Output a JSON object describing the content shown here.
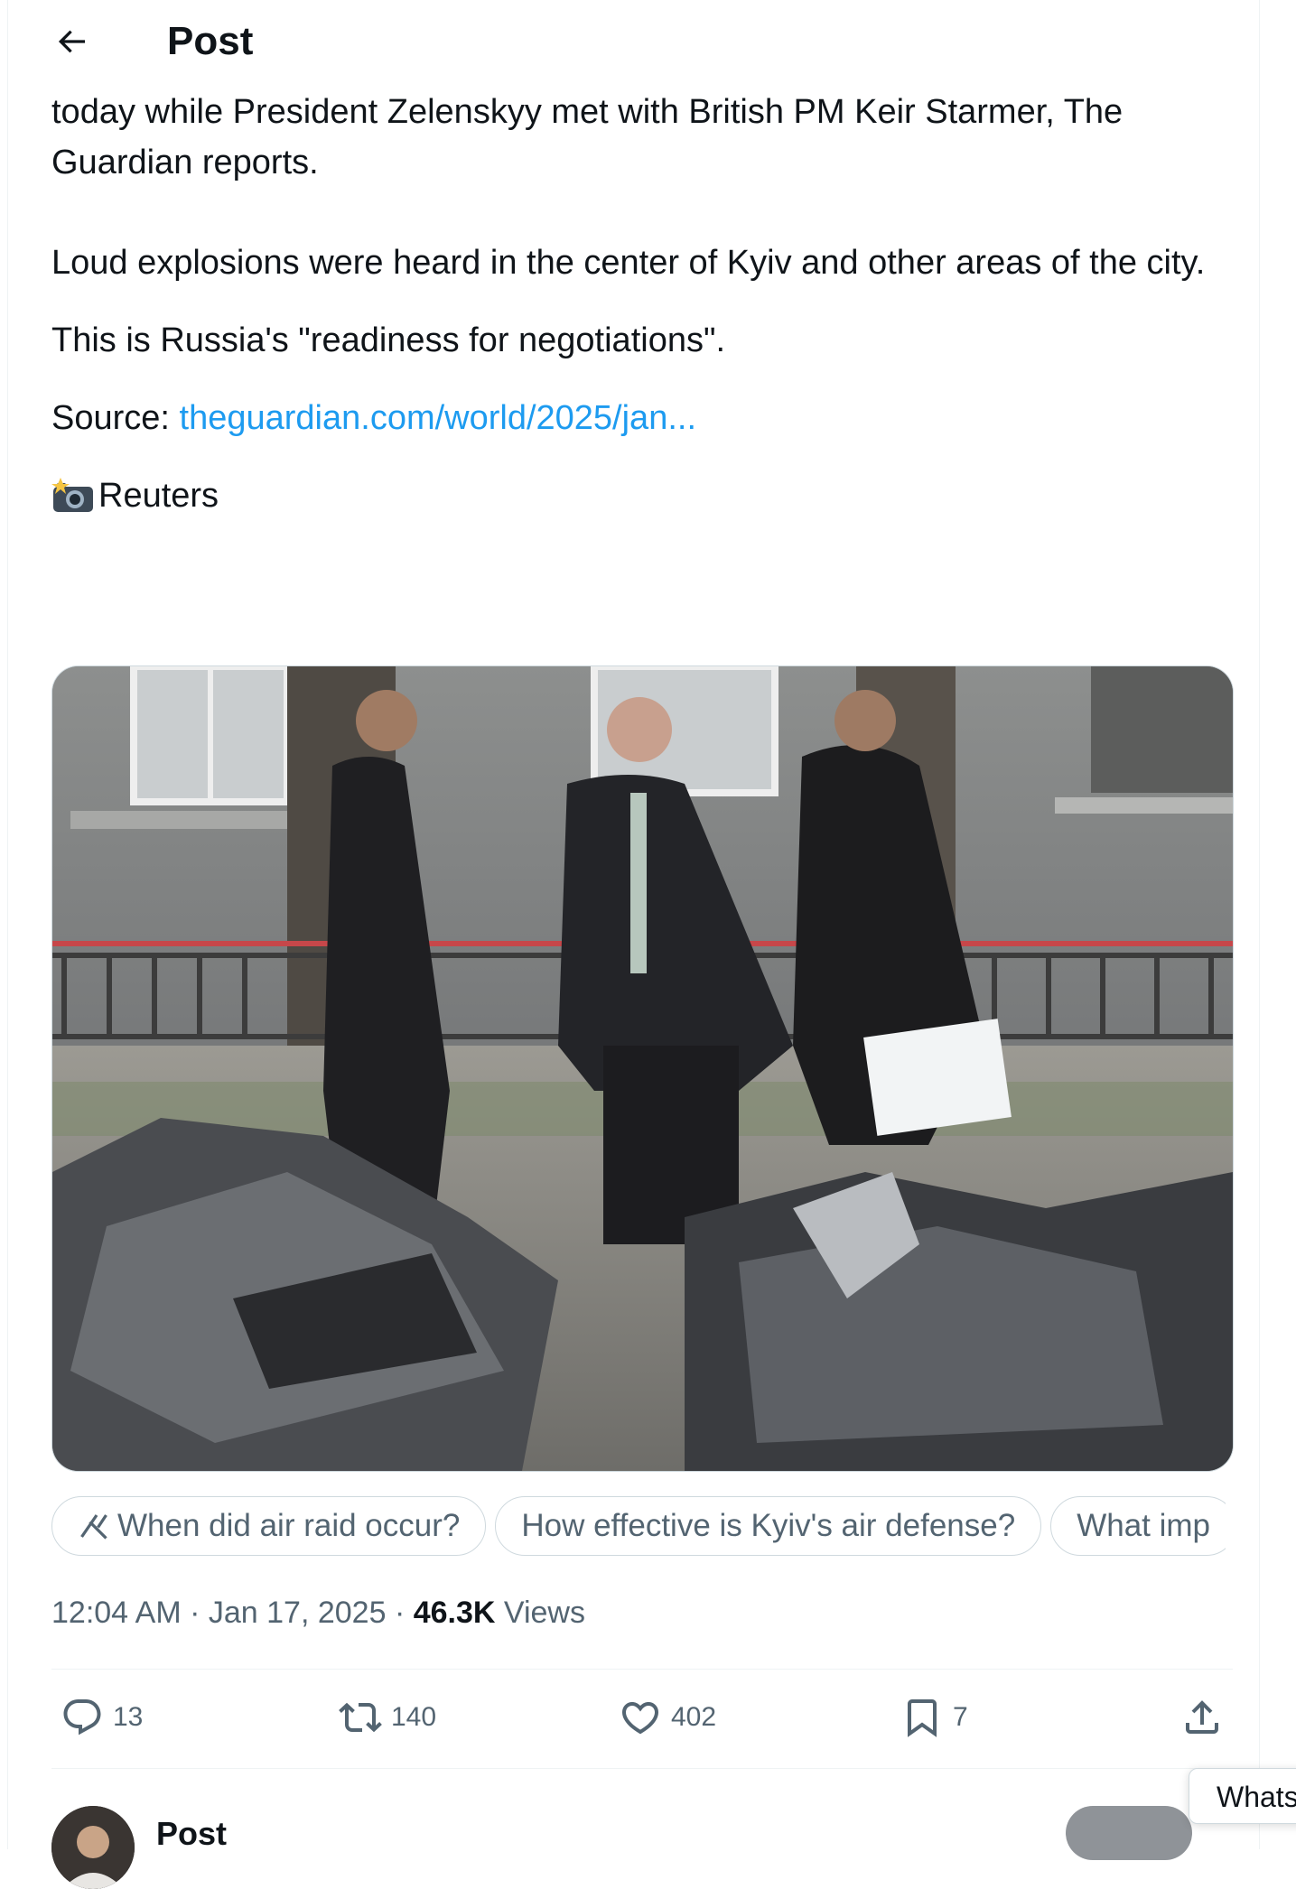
{
  "header": {
    "title": "Post"
  },
  "post": {
    "text_lines": [
      "today while President Zelenskyy met with British PM Keir Starmer, The Guardian reports.",
      "Loud explosions were heard in the center of Kyiv and other areas of the city.",
      "This is Russia's \"readiness for negotiations\"."
    ],
    "source_label": "Source: ",
    "source_link": "theguardian.com/world/2025/jan...",
    "photo_credit": "Reuters"
  },
  "grok_prompts": [
    "When did air raid occur?",
    "How effective is Kyiv's air defense?",
    "What imp"
  ],
  "meta": {
    "time": "12:04 AM",
    "separator": " · ",
    "date": "Jan 17, 2025",
    "views_count": "46.3K",
    "views_label": "Views"
  },
  "actions": {
    "replies": "13",
    "reposts": "140",
    "likes": "402",
    "bookmarks": "7"
  },
  "next_reply": {
    "name": "Post"
  },
  "tooltip": {
    "text": "Whats"
  },
  "colors": {
    "link": "#1d9bf0",
    "muted": "#536471",
    "text": "#0f1419"
  }
}
